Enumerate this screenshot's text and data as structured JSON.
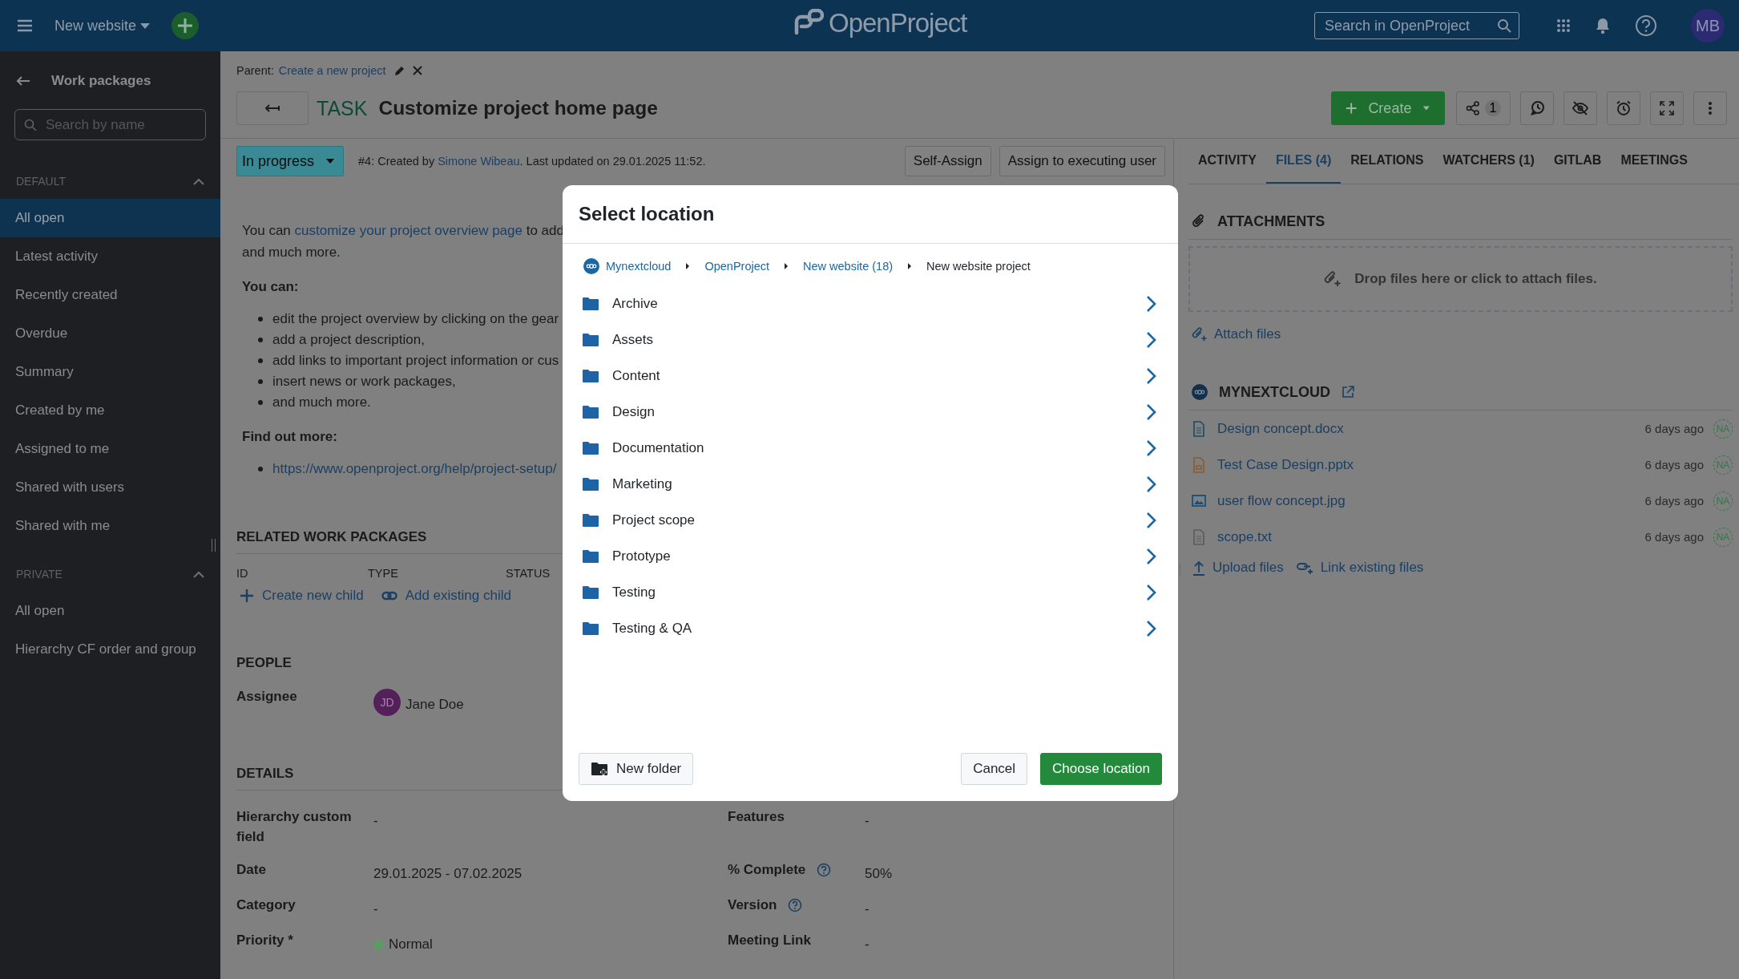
{
  "header": {
    "project": "New website",
    "logo": "OpenProject",
    "search_placeholder": "Search in OpenProject",
    "avatar": "MB"
  },
  "sidebar": {
    "title": "Work packages",
    "search_placeholder": "Search by name",
    "sections": [
      {
        "title": "DEFAULT",
        "expanded": true,
        "items": [
          {
            "label": "All open",
            "selected": true
          },
          {
            "label": "Latest activity",
            "selected": false
          },
          {
            "label": "Recently created",
            "selected": false
          },
          {
            "label": "Overdue",
            "selected": false
          },
          {
            "label": "Summary",
            "selected": false
          },
          {
            "label": "Created by me",
            "selected": false
          },
          {
            "label": "Assigned to me",
            "selected": false
          },
          {
            "label": "Shared with users",
            "selected": false
          },
          {
            "label": "Shared with me",
            "selected": false
          }
        ]
      },
      {
        "title": "PRIVATE",
        "expanded": true,
        "items": [
          {
            "label": "All open",
            "selected": false
          },
          {
            "label": "Hierarchy CF order and group",
            "selected": false
          }
        ]
      }
    ]
  },
  "work_package": {
    "parent_label": "Parent:",
    "parent": "Create a new project",
    "type": "TASK",
    "title": "Customize project home page",
    "create_button": "Create",
    "share_count": "1",
    "status": "In progress",
    "meta_before": "#4: Created by ",
    "meta_author": "Simone Wibeau",
    "meta_after": ". Last updated on 29.01.2025 11:52.",
    "assign_buttons": [
      "Self-Assign",
      "Assign to executing user"
    ]
  },
  "description": {
    "intro_before": "You can ",
    "intro_link": "customize your project overview page",
    "intro_after": " to add",
    "intro_line2": "and much more.",
    "can_heading": "You can:",
    "can_items": [
      "edit the project overview by clicking on the gear",
      "add a project description,",
      "add links to important project information or cus",
      "insert news or work packages,",
      "and much more."
    ],
    "more_heading": "Find out more:",
    "more_links": [
      "https://www.openproject.org/help/project-setup/"
    ]
  },
  "related": {
    "title": "RELATED WORK PACKAGES",
    "columns": [
      "ID",
      "TYPE",
      "STATUS"
    ],
    "actions": [
      {
        "kind": "create",
        "label": "Create new child"
      },
      {
        "kind": "link",
        "label": "Add existing child"
      }
    ]
  },
  "people": {
    "title": "PEOPLE",
    "fields": [
      {
        "label": "Assignee",
        "avatar": "JD",
        "value": "Jane Doe"
      }
    ]
  },
  "details": {
    "title": "DETAILS",
    "fields": [
      {
        "label": "Hierarchy custom field",
        "value": "-"
      },
      {
        "label": "Features",
        "value": "-"
      },
      {
        "label": "Date",
        "value": "29.01.2025 - 07.02.2025"
      },
      {
        "label": "% Complete",
        "value": "50%",
        "help": true
      },
      {
        "label": "Category",
        "value": "-"
      },
      {
        "label": "Version",
        "value": "-",
        "help": true
      },
      {
        "label": "Priority *",
        "value": "Normal",
        "color": "#5e9a64"
      },
      {
        "label": "Meeting Link",
        "value": "-"
      }
    ]
  },
  "files_panel": {
    "tabs": [
      {
        "label": "ACTIVITY",
        "selected": false
      },
      {
        "label": "FILES (4)",
        "selected": true
      },
      {
        "label": "RELATIONS",
        "selected": false
      },
      {
        "label": "WATCHERS (1)",
        "selected": false
      },
      {
        "label": "GITLAB",
        "selected": false
      },
      {
        "label": "MEETINGS",
        "selected": false
      }
    ],
    "attachments": {
      "title": "ATTACHMENTS",
      "drop_text": "Drop files here or click to attach files.",
      "attach_link": "Attach files"
    },
    "storage": {
      "name": "MYNEXTCLOUD",
      "files": [
        {
          "kind": "document",
          "name": "Design concept.docx",
          "time": "6 days ago",
          "user": "NA"
        },
        {
          "kind": "presentation",
          "name": "Test Case Design.pptx",
          "time": "6 days ago",
          "user": "NA"
        },
        {
          "kind": "image",
          "name": "user flow concept.jpg",
          "time": "6 days ago",
          "user": "NA"
        },
        {
          "kind": "text",
          "name": "scope.txt",
          "time": "6 days ago",
          "user": "NA"
        }
      ],
      "actions": [
        {
          "kind": "upload",
          "label": "Upload files"
        },
        {
          "kind": "link",
          "label": "Link existing files"
        }
      ]
    }
  },
  "dialog": {
    "title": "Select location",
    "breadcrumb": [
      {
        "label": "Mynextcloud",
        "current": false
      },
      {
        "label": "OpenProject",
        "current": false
      },
      {
        "label": "New website (18)",
        "current": false
      },
      {
        "label": "New website project",
        "current": true
      }
    ],
    "folders": [
      "Archive",
      "Assets",
      "Content",
      "Design",
      "Documentation",
      "Marketing",
      "Project scope",
      "Prototype",
      "Testing",
      "Testing & QA"
    ],
    "new_folder": "New folder",
    "cancel": "Cancel",
    "confirm": "Choose location"
  }
}
